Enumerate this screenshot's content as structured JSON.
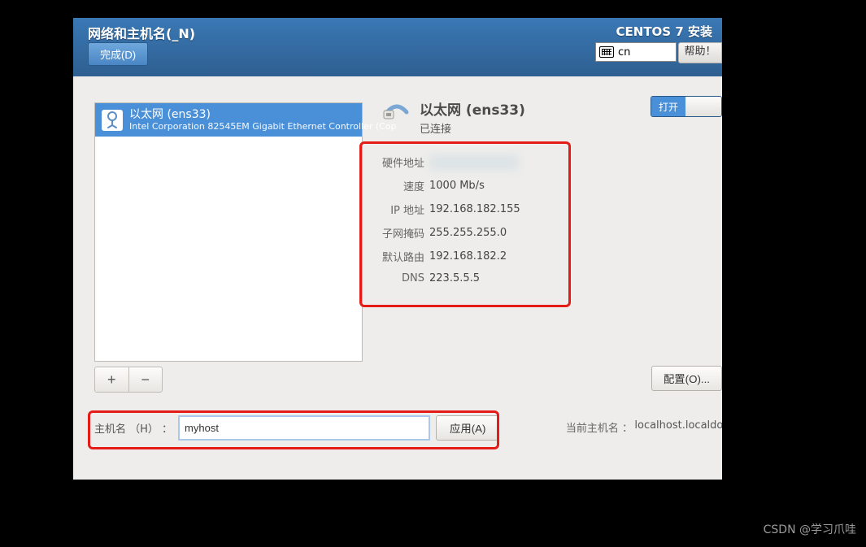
{
  "header": {
    "page_title": "网络和主机名(_N)",
    "done_label": "完成(D)",
    "installer_title": "CENTOS 7 安装",
    "lang": "cn",
    "help_label": "帮助！"
  },
  "device": {
    "name": "以太网 (ens33)",
    "desc": "Intel Corporation 82545EM Gigabit Ethernet Controller (Cop"
  },
  "list_buttons": {
    "add": "+",
    "remove": "−"
  },
  "connection": {
    "title": "以太网 (ens33)",
    "status": "已连接",
    "switch_label": "打开"
  },
  "info_labels": {
    "hw": "硬件地址",
    "speed": "速度",
    "ip": "IP 地址",
    "mask": "子网掩码",
    "gw": "默认路由",
    "dns": "DNS"
  },
  "info_values": {
    "speed": "1000 Mb/s",
    "ip": "192.168.182.155",
    "mask": "255.255.255.0",
    "gw": "192.168.182.2",
    "dns": "223.5.5.5"
  },
  "configure_label": "配置(O)...",
  "hostname": {
    "label": "主机名 （H） ：",
    "value": "myhost",
    "apply_label": "应用(A)",
    "current_label": "当前主机名 ：",
    "current_value": "localhost.localdoma"
  },
  "watermark": "CSDN @学习爪哇"
}
